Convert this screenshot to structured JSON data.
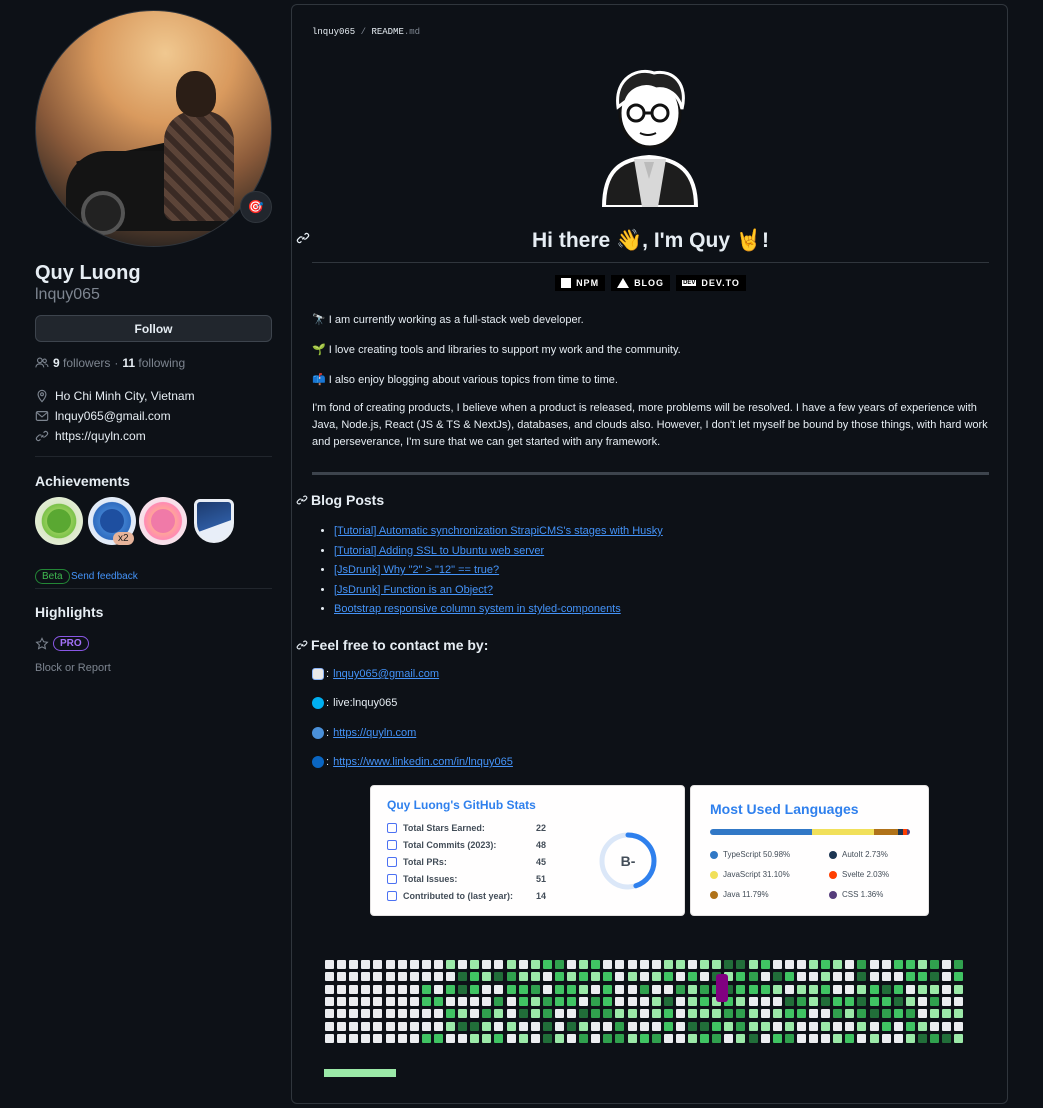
{
  "profile": {
    "name": "Quy Luong",
    "login": "lnquy065",
    "follow_label": "Follow",
    "followers_count": "9",
    "followers_label": "followers",
    "following_count": "11",
    "following_label": "following",
    "location": "Ho Chi Minh City, Vietnam",
    "email": "lnquy065@gmail.com",
    "website": "https://quyln.com",
    "status_emoji": "🎯"
  },
  "achievements": {
    "title": "Achievements",
    "multiplier": "x2",
    "beta_label": "Beta",
    "feedback_label": "Send feedback"
  },
  "highlights": {
    "title": "Highlights",
    "pro_label": "PRO",
    "block_label": "Block or Report"
  },
  "readme": {
    "breadcrumb_user": "lnquy065",
    "breadcrumb_sep": "/",
    "breadcrumb_file": "README",
    "breadcrumb_ext": ".md",
    "heading": "Hi there 👋, I'm Quy 🤘!",
    "shields": [
      {
        "label": "NPM",
        "icon": "npm-icon"
      },
      {
        "label": "BLOG",
        "icon": "vercel-triangle-icon"
      },
      {
        "label": "DEV.TO",
        "icon": "dev-icon"
      }
    ],
    "intro_lines": [
      "🔭 I am currently working as a full-stack web developer.",
      "🌱 I love creating tools and libraries to support my work and the community.",
      "📫 I also enjoy blogging about various topics from time to time."
    ],
    "paragraph": "I'm fond of creating products, I believe when a product is released, more problems will be resolved. I have a few years of experience with Java, Node.js, React (JS & TS & NextJs), databases, and clouds also. However, I don't let myself be bound by those things, with hard work and perseverance, I'm sure that we can get started with any framework.",
    "blog_heading": "Blog Posts",
    "blog_posts": [
      "[Tutorial] Automatic synchronization StrapiCMS's stages with Husky",
      "[Tutorial] Adding SSL to Ubuntu web server",
      "[JsDrunk] Why \"2\" > \"12\" == true?",
      "[JsDrunk] Function is an Object?",
      "Bootstrap responsive column system in styled-components"
    ],
    "contact_heading": "Feel free to contact me by:",
    "contact": {
      "email": "lnquy065@gmail.com",
      "skype": "live:lnquy065",
      "website": "https://quyln.com",
      "linkedin": "https://www.linkedin.com/in/lnquy065"
    }
  },
  "stats_card": {
    "title": "Quy Luong's GitHub Stats",
    "rows": [
      {
        "label": "Total Stars Earned:",
        "value": "22",
        "icon": "star-icon"
      },
      {
        "label": "Total Commits (2023):",
        "value": "48",
        "icon": "history-icon"
      },
      {
        "label": "Total PRs:",
        "value": "45",
        "icon": "pull-request-icon"
      },
      {
        "label": "Total Issues:",
        "value": "51",
        "icon": "issue-icon"
      },
      {
        "label": "Contributed to (last year):",
        "value": "14",
        "icon": "repo-icon"
      }
    ],
    "rank": "B-",
    "rank_progress": 0.45
  },
  "languages_card": {
    "title": "Most Used Languages",
    "languages": [
      {
        "name": "TypeScript 50.98%",
        "percent": 50.98,
        "color": "#3178c6"
      },
      {
        "name": "AutoIt 2.73%",
        "percent": 2.73,
        "color": "#1c3552"
      },
      {
        "name": "JavaScript 31.10%",
        "percent": 31.1,
        "color": "#f1e05a"
      },
      {
        "name": "Svelte 2.03%",
        "percent": 2.03,
        "color": "#ff3e00"
      },
      {
        "name": "Java 11.79%",
        "percent": 11.79,
        "color": "#b07219"
      },
      {
        "name": "CSS 1.36%",
        "percent": 1.36,
        "color": "#563d7c"
      }
    ]
  },
  "contribution": {
    "levels": [
      "#ebedf0",
      "#9be9a8",
      "#40c463",
      "#30a14e",
      "#216e39"
    ],
    "snake_color": "#800080",
    "progress_color": "#9be9a8"
  }
}
